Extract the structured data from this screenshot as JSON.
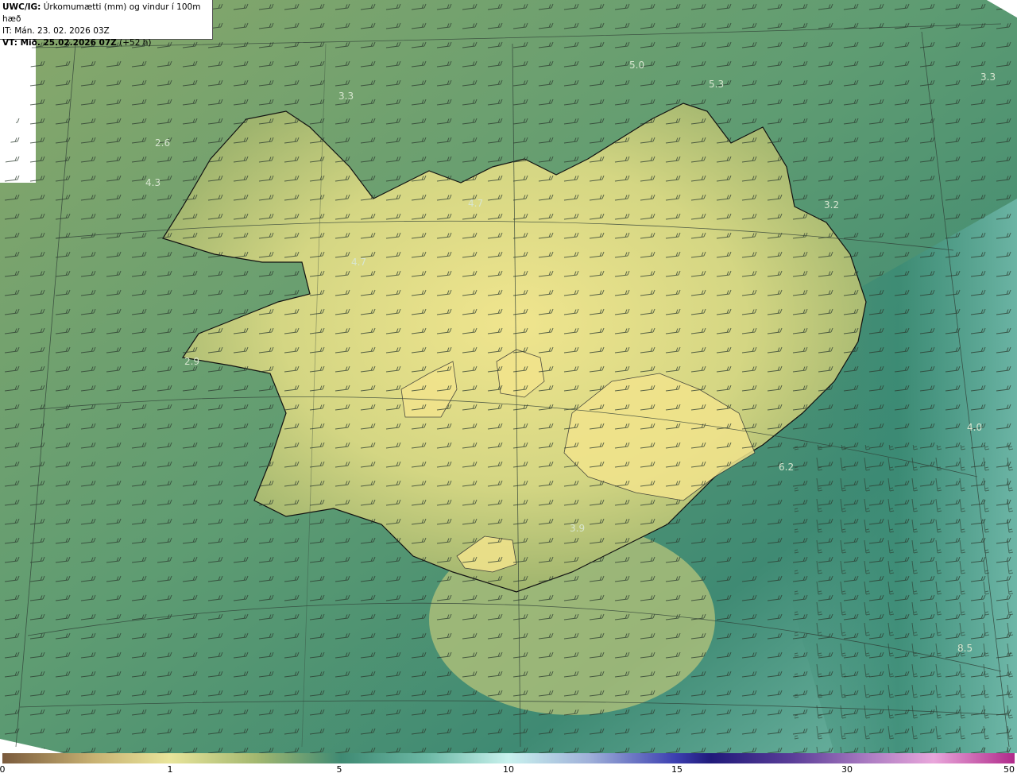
{
  "info": {
    "line1_bold": "UWC/IG:",
    "line1_rest": " Úrkomumætti (mm) og vindur í 100m hæð",
    "line2": "IT: Mán. 23. 02. 2026 03Z",
    "line3_bold": "VT: Mið. 25.02.2026 07Z",
    "line3_rest": " (+52 h)"
  },
  "map_labels": [
    {
      "text": "5.0"
    },
    {
      "text": "5.3"
    },
    {
      "text": "3.3"
    },
    {
      "text": "3.3"
    },
    {
      "text": "2.6"
    },
    {
      "text": "4.3"
    },
    {
      "text": "4.7"
    },
    {
      "text": "4.7"
    },
    {
      "text": "3.2"
    },
    {
      "text": "2.9"
    },
    {
      "text": "4.0"
    },
    {
      "text": "6.2"
    },
    {
      "text": "3.9"
    },
    {
      "text": "8.5"
    }
  ],
  "colorbar": {
    "ticks": [
      "0",
      "1",
      "5",
      "10",
      "15",
      "30",
      "50"
    ]
  },
  "colors": {
    "land_light": "#e8e38c",
    "mid": "#a9b66f",
    "sea_dark": "#3f8a73",
    "sea_light": "#7fc3b2",
    "coast": "#111111",
    "label": "#d8e6d0"
  }
}
